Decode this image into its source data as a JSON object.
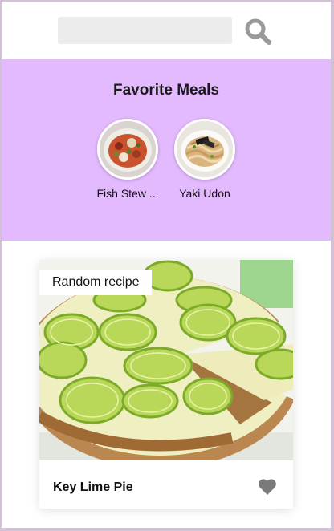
{
  "search": {
    "value": "",
    "placeholder": "",
    "button_icon": "search-icon"
  },
  "favorites": {
    "title": "Favorite Meals",
    "items": [
      {
        "label": "Fish Stew ..."
      },
      {
        "label": "Yaki Udon"
      }
    ]
  },
  "random_meal": {
    "badge": "Random recipe",
    "name": "Key Lime Pie",
    "favorite_icon": "heart-icon"
  },
  "colors": {
    "page_border": "#d3c2d6",
    "favorites_background": "#e4baff",
    "search_background": "#ececec",
    "icon_gray": "#999999"
  }
}
